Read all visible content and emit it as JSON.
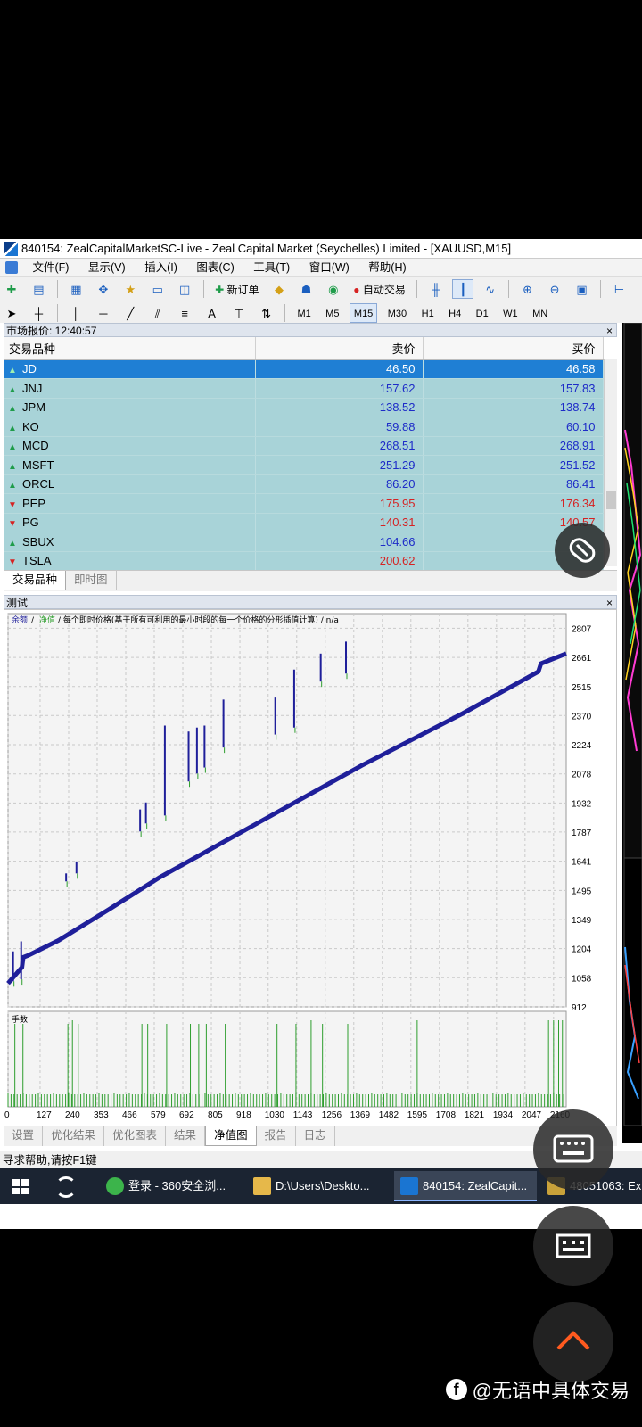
{
  "window": {
    "title": "840154: ZealCapitalMarketSC-Live - Zeal Capital Market (Seychelles) Limited - [XAUUSD,M15]"
  },
  "menu": [
    "文件(F)",
    "显示(V)",
    "插入(I)",
    "图表(C)",
    "工具(T)",
    "窗口(W)",
    "帮助(H)"
  ],
  "toolbar": {
    "new_order": "新订单",
    "auto_trade": "自动交易"
  },
  "drawing_toolbar": {
    "text_tool": "A"
  },
  "timeframes": [
    "M1",
    "M5",
    "M15",
    "M30",
    "H1",
    "H4",
    "D1",
    "W1",
    "MN"
  ],
  "selected_timeframe": "M15",
  "market_watch": {
    "header": "市场报价: 12:40:57",
    "columns": [
      "交易品种",
      "卖价",
      "买价"
    ],
    "rows": [
      {
        "symbol": "JD",
        "bid": "46.50",
        "ask": "46.58",
        "dir": "up",
        "selected": true
      },
      {
        "symbol": "JNJ",
        "bid": "157.62",
        "ask": "157.83",
        "dir": "up"
      },
      {
        "symbol": "JPM",
        "bid": "138.52",
        "ask": "138.74",
        "dir": "up"
      },
      {
        "symbol": "KO",
        "bid": "59.88",
        "ask": "60.10",
        "dir": "up"
      },
      {
        "symbol": "MCD",
        "bid": "268.51",
        "ask": "268.91",
        "dir": "up"
      },
      {
        "symbol": "MSFT",
        "bid": "251.29",
        "ask": "251.52",
        "dir": "up"
      },
      {
        "symbol": "ORCL",
        "bid": "86.20",
        "ask": "86.41",
        "dir": "up"
      },
      {
        "symbol": "PEP",
        "bid": "175.95",
        "ask": "176.34",
        "dir": "down"
      },
      {
        "symbol": "PG",
        "bid": "140.31",
        "ask": "140.57",
        "dir": "down"
      },
      {
        "symbol": "SBUX",
        "bid": "104.66",
        "ask": "",
        "dir": "up"
      },
      {
        "symbol": "TSLA",
        "bid": "200.62",
        "ask": "",
        "dir": "down"
      }
    ],
    "tabs": [
      "交易品种",
      "即时图"
    ],
    "active_tab": "交易品种"
  },
  "tester": {
    "header": "测试",
    "tabs": [
      "设置",
      "优化结果",
      "优化图表",
      "结果",
      "净值图",
      "报告",
      "日志"
    ],
    "active_tab": "净值图",
    "legend": {
      "balance": "余额",
      "slash": "/",
      "equity": "净值",
      "desc": "/ 每个即时价格(基于所有可利用的最小时段的每一个价格的分形插值计算) / n/a"
    },
    "sub_label": "手数"
  },
  "chart_data": {
    "type": "line",
    "series": [
      {
        "name": "余额",
        "color": "#1f1f9a"
      },
      {
        "name": "净值",
        "color": "#2e9e2e"
      }
    ],
    "y_ticks": [
      2807,
      2661,
      2515,
      2370,
      2224,
      2078,
      1932,
      1787,
      1641,
      1495,
      1349,
      1204,
      1058,
      912
    ],
    "ylim": [
      912,
      2880
    ],
    "x_ticks": [
      0,
      127,
      240,
      353,
      466,
      579,
      692,
      805,
      918,
      1030,
      1143,
      1256,
      1369,
      1482,
      1595,
      1708,
      1821,
      1934,
      2047,
      2160
    ],
    "xlim": [
      0,
      2210
    ],
    "balance": {
      "x": [
        0,
        55,
        60,
        80,
        200,
        400,
        600,
        800,
        1000,
        1200,
        1400,
        1600,
        1800,
        2000,
        2100,
        2110,
        2210
      ],
      "y": [
        1030,
        1110,
        1160,
        1170,
        1245,
        1400,
        1560,
        1700,
        1840,
        1980,
        2120,
        2250,
        2380,
        2520,
        2590,
        2630,
        2680
      ]
    },
    "equity_spikes": [
      {
        "x": 20,
        "top": 1190,
        "bottom": 1040
      },
      {
        "x": 52,
        "top": 1240,
        "bottom": 1050
      },
      {
        "x": 230,
        "top": 1580,
        "bottom": 1540
      },
      {
        "x": 271,
        "top": 1640,
        "bottom": 1580
      },
      {
        "x": 523,
        "top": 1900,
        "bottom": 1790
      },
      {
        "x": 546,
        "top": 1935,
        "bottom": 1830
      },
      {
        "x": 621,
        "top": 2320,
        "bottom": 1870
      },
      {
        "x": 715,
        "top": 2290,
        "bottom": 2040
      },
      {
        "x": 748,
        "top": 2310,
        "bottom": 2080
      },
      {
        "x": 778,
        "top": 2320,
        "bottom": 2110
      },
      {
        "x": 853,
        "top": 2450,
        "bottom": 2210
      },
      {
        "x": 1058,
        "top": 2460,
        "bottom": 2275
      },
      {
        "x": 1133,
        "top": 2600,
        "bottom": 2310
      },
      {
        "x": 1238,
        "top": 2680,
        "bottom": 2540
      },
      {
        "x": 1338,
        "top": 2740,
        "bottom": 2580
      }
    ],
    "volume_spikes": [
      255,
      1200,
      1620,
      2140,
      2160,
      2180,
      2195
    ]
  },
  "taskbar": {
    "items": [
      "登录 - 360安全浏...",
      "D:\\Users\\Deskto...",
      "840154: ZealCapit...",
      "48051063: Ex"
    ]
  },
  "status": "寻求帮助,请按F1键",
  "watermark": "@无语中具体交易"
}
